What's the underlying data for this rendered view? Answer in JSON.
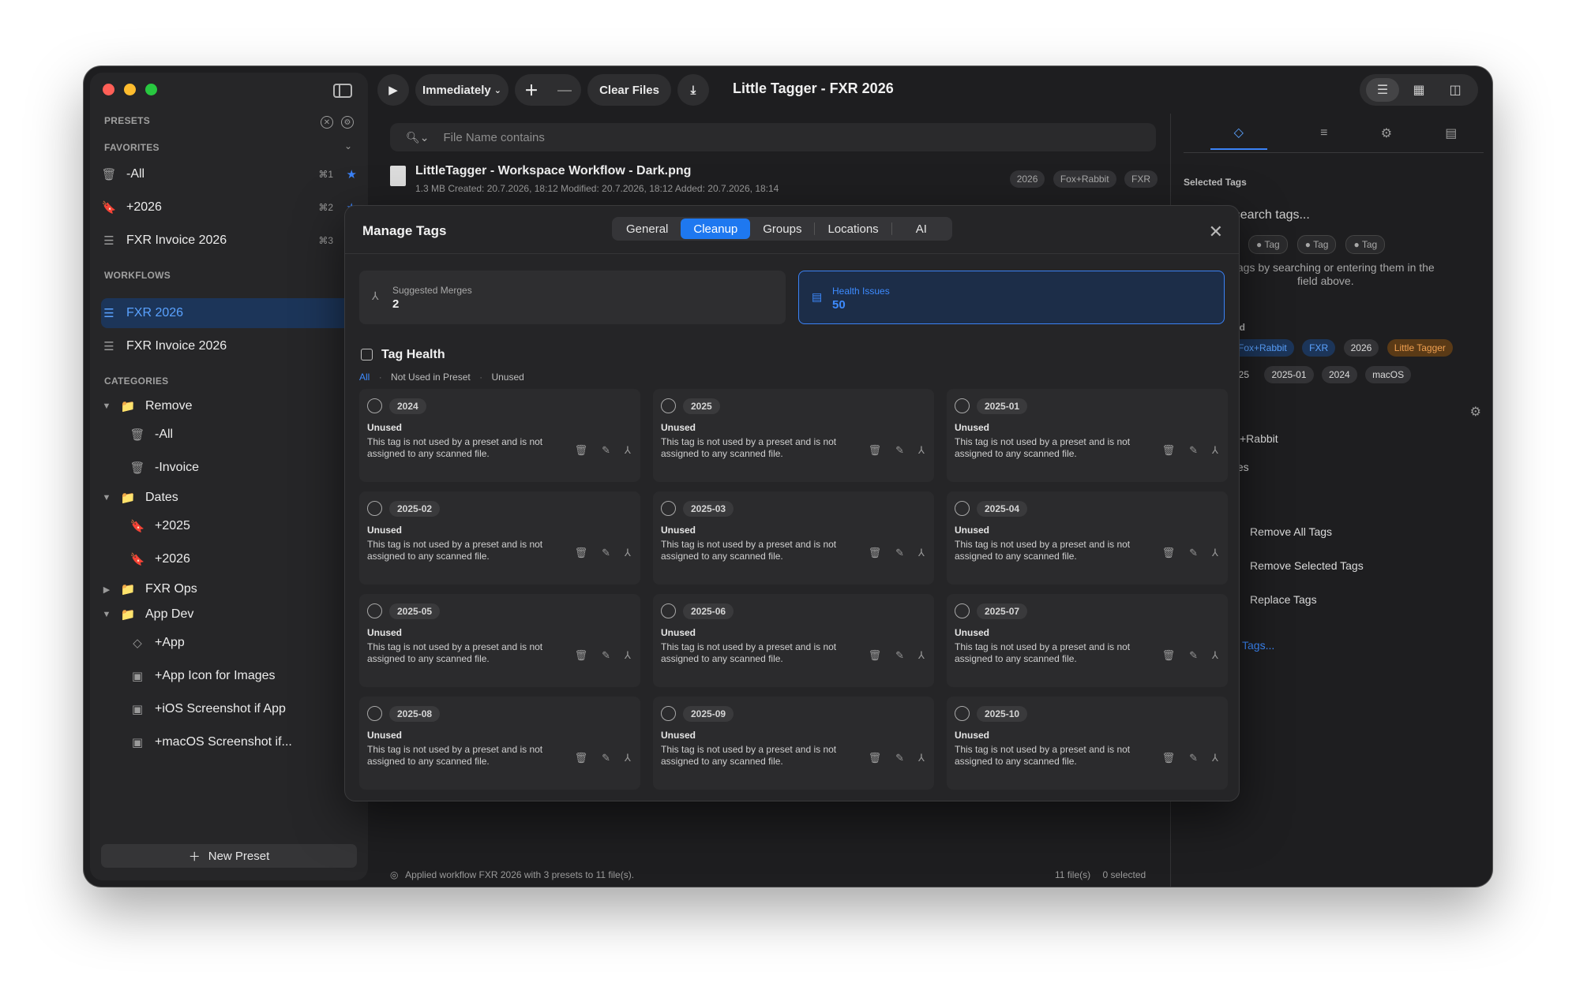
{
  "toolbar": {
    "run_mode": "Immediately",
    "clear_files": "Clear Files",
    "title": "Little Tagger - FXR 2026"
  },
  "sidebar": {
    "presets_label": "PRESETS",
    "favorites_label": "FAVORITES",
    "favorites": [
      {
        "label": "-All",
        "shortcut": "⌘1"
      },
      {
        "label": "+2026",
        "shortcut": "⌘2"
      },
      {
        "label": "FXR Invoice 2026",
        "shortcut": "⌘3"
      }
    ],
    "workflows_label": "WORKFLOWS",
    "workflows": [
      {
        "label": "FXR 2026"
      },
      {
        "label": "FXR Invoice 2026"
      }
    ],
    "categories_label": "CATEGORIES",
    "categories": {
      "remove": "Remove",
      "remove_items": [
        "-All",
        "-Invoice"
      ],
      "dates": "Dates",
      "dates_items": [
        "+2025",
        "+2026"
      ],
      "fxr_ops": "FXR Ops",
      "app_dev": "App Dev",
      "app_dev_items": [
        "+App",
        "+App Icon for Images",
        "+iOS Screenshot if App",
        "+macOS Screenshot if..."
      ]
    },
    "new_preset": "New Preset"
  },
  "main": {
    "search_placeholder": "File Name contains",
    "file": {
      "name": "LittleTagger - Workspace Workflow - Dark.png",
      "meta": "1.3 MB   Created: 20.7.2026, 18:12   Modified: 20.7.2026, 18:12   Added: 20.7.2026, 18:14",
      "tags": [
        "2026",
        "Fox+Rabbit",
        "FXR"
      ]
    },
    "status": "Applied workflow FXR 2026 with 3 presets to 11 file(s).",
    "count": "11 file(s)",
    "selected": "0 selected"
  },
  "inspector": {
    "selected_tags_label": "Selected Tags",
    "search_partial": "r search tags...",
    "placeholder_tags": [
      "Tag",
      "Tag",
      "Tag"
    ],
    "hint_line1": "tags by searching or entering them in the",
    "hint_line2": "field above.",
    "used_label": "ed",
    "used_tags": [
      "Fox+Rabbit",
      "FXR",
      "2026",
      "Little Tagger"
    ],
    "used_tags_row2": [
      "025",
      "2025-01",
      "2024",
      "macOS"
    ],
    "list_a": "x+Rabbit",
    "list_b": "tes",
    "actions": [
      "Remove All Tags",
      "Remove Selected Tags",
      "Replace Tags"
    ],
    "more_link": "Tags..."
  },
  "modal": {
    "title": "Manage Tags",
    "tabs": [
      "General",
      "Cleanup",
      "Groups",
      "Locations",
      "AI"
    ],
    "selected_tab": "Cleanup",
    "suggested_label": "Suggested Merges",
    "suggested_value": "2",
    "health_label": "Health Issues",
    "health_value": "50",
    "tag_health": "Tag Health",
    "filters": [
      "All",
      "Not Used in Preset",
      "Unused"
    ],
    "card_state": "Unused",
    "card_desc": "This tag is not used by a preset and is not assigned to any scanned file.",
    "cards": [
      "2024",
      "2025",
      "2025-01",
      "2025-02",
      "2025-03",
      "2025-04",
      "2025-05",
      "2025-06",
      "2025-07",
      "2025-08",
      "2025-09",
      "2025-10"
    ]
  },
  "colors": {
    "accent": "#1e78f0",
    "accent_text": "#3d8bff",
    "window_bg": "#1e1e20",
    "sidebar_bg": "#262628",
    "orange_tag": "#e28a2b"
  }
}
